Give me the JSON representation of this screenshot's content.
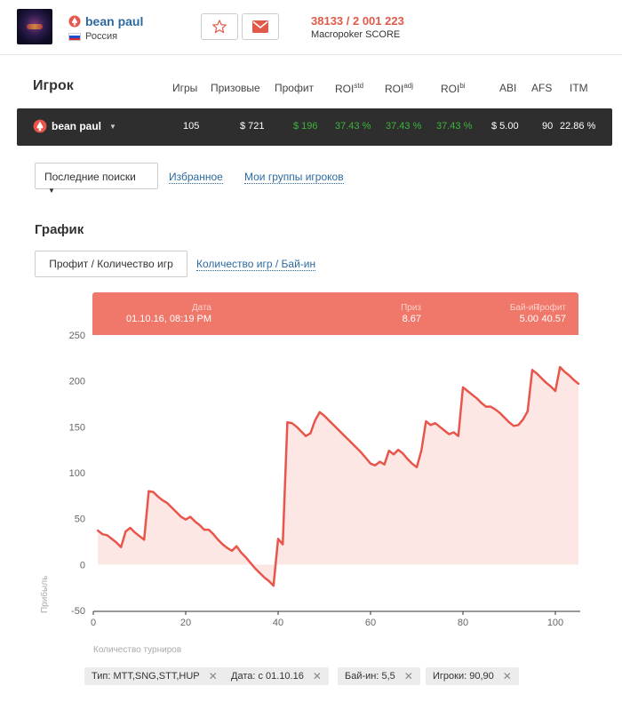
{
  "header": {
    "player_name": "bean paul",
    "country": "Россия",
    "flag_colors": [
      "#ffffff",
      "#1c4fd0",
      "#d8282a"
    ],
    "score_value": "38133 / 2 001 223",
    "score_label": "Macropoker SCORE",
    "favorite_icon": "star-icon",
    "message_icon": "envelope-icon",
    "accent_color": "#e05a4a"
  },
  "stats": {
    "title": "Игрок",
    "columns": {
      "games": "Игры",
      "prizes": "Призовые",
      "profit": "Профит",
      "roi_std_base": "ROI",
      "roi_std_sup": "std",
      "roi_adj_base": "ROI",
      "roi_adj_sup": "adj",
      "roi_bi_base": "ROI",
      "roi_bi_sup": "bi",
      "abi": "ABI",
      "afs": "AFS",
      "itm": "ITM"
    },
    "row": {
      "name": "bean paul",
      "games": "105",
      "prizes": "$ 721",
      "profit": "$ 196",
      "roi_std": "37.43 %",
      "roi_adj": "37.43 %",
      "roi_bi": "37.43 %",
      "abi": "$ 5.00",
      "afs": "90",
      "itm": "22.86 %"
    }
  },
  "search": {
    "dropdown_label": "Последние поиски",
    "favorites_link": "Избранное",
    "groups_link": "Мои группы игроков"
  },
  "chart_section": {
    "title": "График",
    "active_tab": "Профит / Количество игр",
    "other_tab": "Количество игр / Бай-ин"
  },
  "tooltip": {
    "date_label": "Дата",
    "date_value": "01.10.16, 08:19 PM",
    "prize_label": "Приз",
    "prize_value": "8.67",
    "buyin_label": "Бай-ин",
    "buyin_value": "5.00",
    "profit_label": "Профит",
    "profit_value": "40.57"
  },
  "chart_data": {
    "type": "area",
    "title": "",
    "xlabel": "Количество турниров",
    "ylabel": "Прибыль",
    "xlim": [
      0,
      105
    ],
    "ylim": [
      -50,
      250
    ],
    "xticks": [
      0,
      20,
      40,
      60,
      80,
      100
    ],
    "yticks": [
      -50,
      0,
      50,
      100,
      150,
      200,
      250
    ],
    "line_color": "#e8554a",
    "fill_color": "#fde7e5",
    "series": [
      {
        "x": [
          1,
          2,
          3,
          4,
          5,
          6,
          7,
          8,
          9,
          10,
          11,
          12,
          13,
          14,
          15,
          16,
          17,
          18,
          19,
          20,
          21,
          22,
          23,
          24,
          25,
          26,
          27,
          28,
          29,
          30,
          31,
          32,
          33,
          34,
          35,
          36,
          37,
          38,
          39,
          40,
          41,
          42,
          43,
          44,
          45,
          46,
          47,
          48,
          49,
          50,
          51,
          52,
          53,
          54,
          55,
          56,
          57,
          58,
          59,
          60,
          61,
          62,
          63,
          64,
          65,
          66,
          67,
          68,
          69,
          70,
          71,
          72,
          73,
          74,
          75,
          76,
          77,
          78,
          79,
          80,
          81,
          82,
          83,
          84,
          85,
          86,
          87,
          88,
          89,
          90,
          91,
          92,
          93,
          94,
          95,
          96,
          97,
          98,
          99,
          100,
          101,
          102,
          103,
          104,
          105
        ],
        "values": [
          37,
          33,
          32,
          28,
          24,
          19,
          36,
          40,
          35,
          31,
          27,
          80,
          79,
          74,
          70,
          67,
          62,
          57,
          52,
          49,
          52,
          47,
          43,
          38,
          38,
          33,
          27,
          22,
          18,
          15,
          20,
          13,
          8,
          2,
          -4,
          -9,
          -14,
          -18,
          -23,
          28,
          22,
          155,
          154,
          150,
          145,
          140,
          143,
          157,
          166,
          162,
          157,
          152,
          147,
          142,
          137,
          132,
          127,
          122,
          116,
          110,
          108,
          112,
          109,
          124,
          120,
          125,
          121,
          115,
          110,
          106,
          124,
          156,
          152,
          154,
          150,
          146,
          142,
          144,
          140,
          193,
          189,
          185,
          181,
          176,
          172,
          172,
          169,
          165,
          160,
          155,
          151,
          152,
          158,
          167,
          212,
          208,
          203,
          198,
          194,
          189,
          215,
          210,
          206,
          201,
          197
        ]
      }
    ]
  },
  "filters": [
    "Тип: MTT,SNG,STT,HUP",
    "Дата: с 01.10.16",
    "Бай-ин: 5,5",
    "Игроки: 90,90"
  ]
}
